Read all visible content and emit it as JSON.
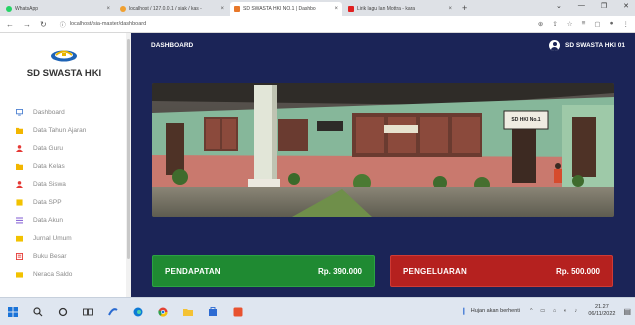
{
  "browser": {
    "tabs": [
      {
        "label": "WhatsApp",
        "color": "#25d366"
      },
      {
        "label": "localhost / 127.0.0.1 / siak / kas - ",
        "color": "#f0a030"
      },
      {
        "label": "SD SWASTA HKI NO.1 | Dashbo",
        "color": "#e8782a",
        "active": true
      },
      {
        "label": "Lirik lagu Ian Mottra - kara",
        "color": "#e02020"
      }
    ],
    "new_tab": "+",
    "url": "localhost/sia-master/dashboard"
  },
  "sidebar": {
    "school_name": "SD SWASTA HKI",
    "items": [
      {
        "label": "Dashboard",
        "icon": "monitor-icon",
        "color": "#4a7fd0"
      },
      {
        "label": "Data Tahun Ajaran",
        "icon": "folder-icon",
        "color": "#f2b600"
      },
      {
        "label": "Data Guru",
        "icon": "user-icon",
        "color": "#e53935"
      },
      {
        "label": "Data Kelas",
        "icon": "folder-icon",
        "color": "#f2b600"
      },
      {
        "label": "Data Siswa",
        "icon": "user-icon",
        "color": "#e53935"
      },
      {
        "label": "Data SPP",
        "icon": "document-icon",
        "color": "#f2c200"
      },
      {
        "label": "Data Akun",
        "icon": "list-icon",
        "color": "#8e6dd8"
      },
      {
        "label": "Jurnal Umum",
        "icon": "book-icon",
        "color": "#f2c200"
      },
      {
        "label": "Buku Besar",
        "icon": "ledger-icon",
        "color": "#e53935"
      },
      {
        "label": "Neraca Saldo",
        "icon": "balance-icon",
        "color": "#f2c200"
      }
    ]
  },
  "header": {
    "title": "DASHBOARD",
    "user_name": "SD SWASTA HKI 01"
  },
  "cards": {
    "income_label": "PENDAPATAN",
    "income_value": "Rp. 390.000",
    "expense_label": "PENGELUARAN",
    "expense_value": "Rp. 500.000"
  },
  "photo": {
    "sign_text": "SD HKI No.1"
  },
  "taskbar": {
    "weather_text": "Hujan akan berhenti",
    "time": "21.27",
    "date": "06/11/2022"
  },
  "colors": {
    "main_bg": "#1b2457",
    "income": "#1f8a32",
    "expense": "#b5211f"
  }
}
